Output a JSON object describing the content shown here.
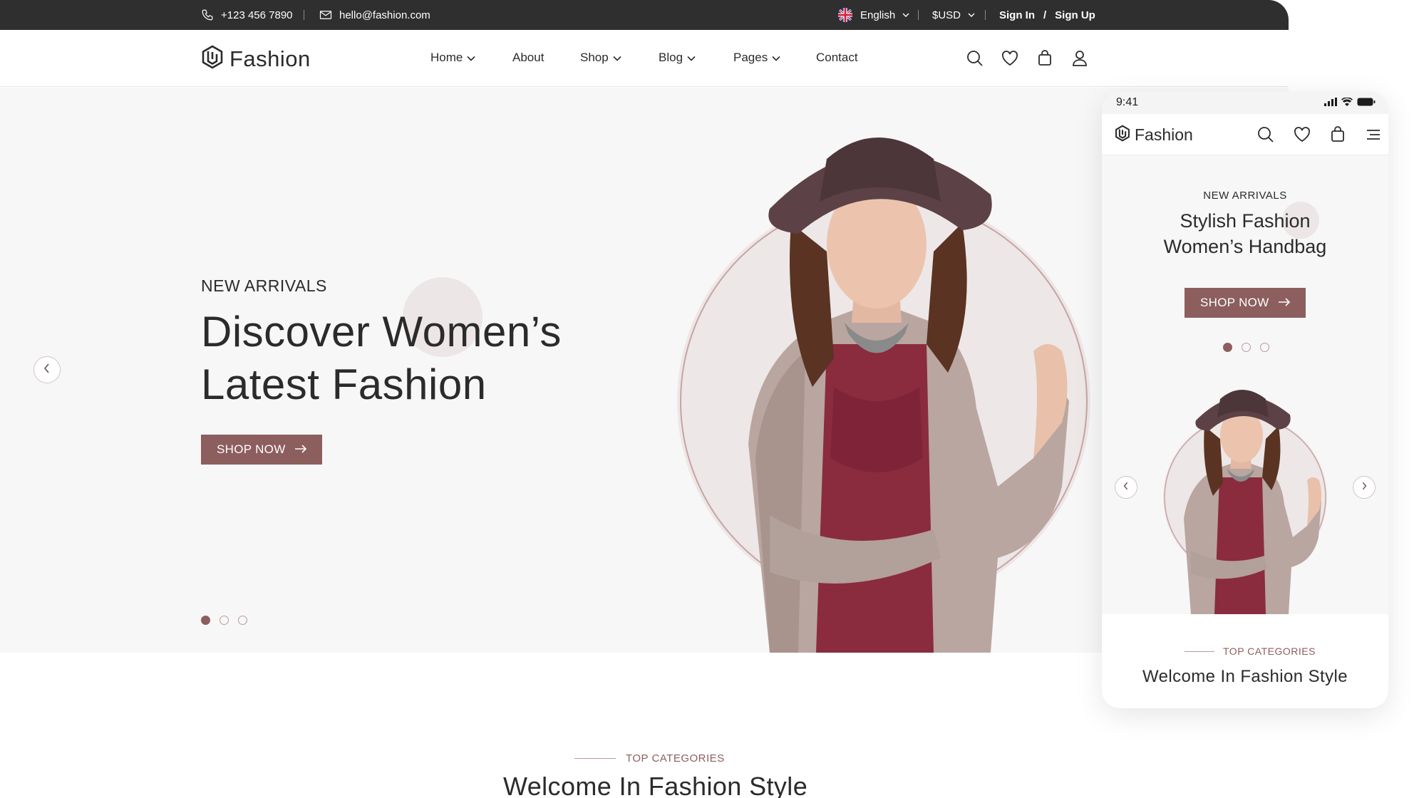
{
  "topbar": {
    "phone": "+123 456 7890",
    "email": "hello@fashion.com",
    "language": "English",
    "currency": "$USD",
    "sign_in": "Sign In",
    "auth_sep": "/",
    "sign_up": "Sign Up"
  },
  "brand": {
    "name": "Fashion"
  },
  "nav": [
    {
      "label": "Home",
      "dropdown": true
    },
    {
      "label": "About",
      "dropdown": false
    },
    {
      "label": "Shop",
      "dropdown": true
    },
    {
      "label": "Blog",
      "dropdown": true
    },
    {
      "label": "Pages",
      "dropdown": true
    },
    {
      "label": "Contact",
      "dropdown": false
    }
  ],
  "header_icons": [
    "search-icon",
    "heart-icon",
    "bag-icon",
    "user-icon"
  ],
  "hero": {
    "eyebrow": "NEW ARRIVALS",
    "headline_line1": "Discover Women’s",
    "headline_line2": "Latest Fashion",
    "cta": "SHOP NOW",
    "slides": 3,
    "active_slide": 1
  },
  "categories": {
    "eyebrow": "TOP CATEGORIES",
    "title": "Welcome In Fashion Style"
  },
  "mobile": {
    "time": "9:41",
    "eyebrow": "NEW ARRIVALS",
    "title_line1": "Stylish Fashion",
    "title_line2": "Women’s Handbag",
    "cta": "SHOP NOW",
    "categories_eyebrow": "TOP CATEGORIES",
    "categories_title": "Welcome In Fashion Style"
  },
  "colors": {
    "accent": "#8d5e5e",
    "topbar_bg": "#2f2f2f",
    "hero_bg": "#f8f7f7",
    "text": "#2b2b2b"
  }
}
